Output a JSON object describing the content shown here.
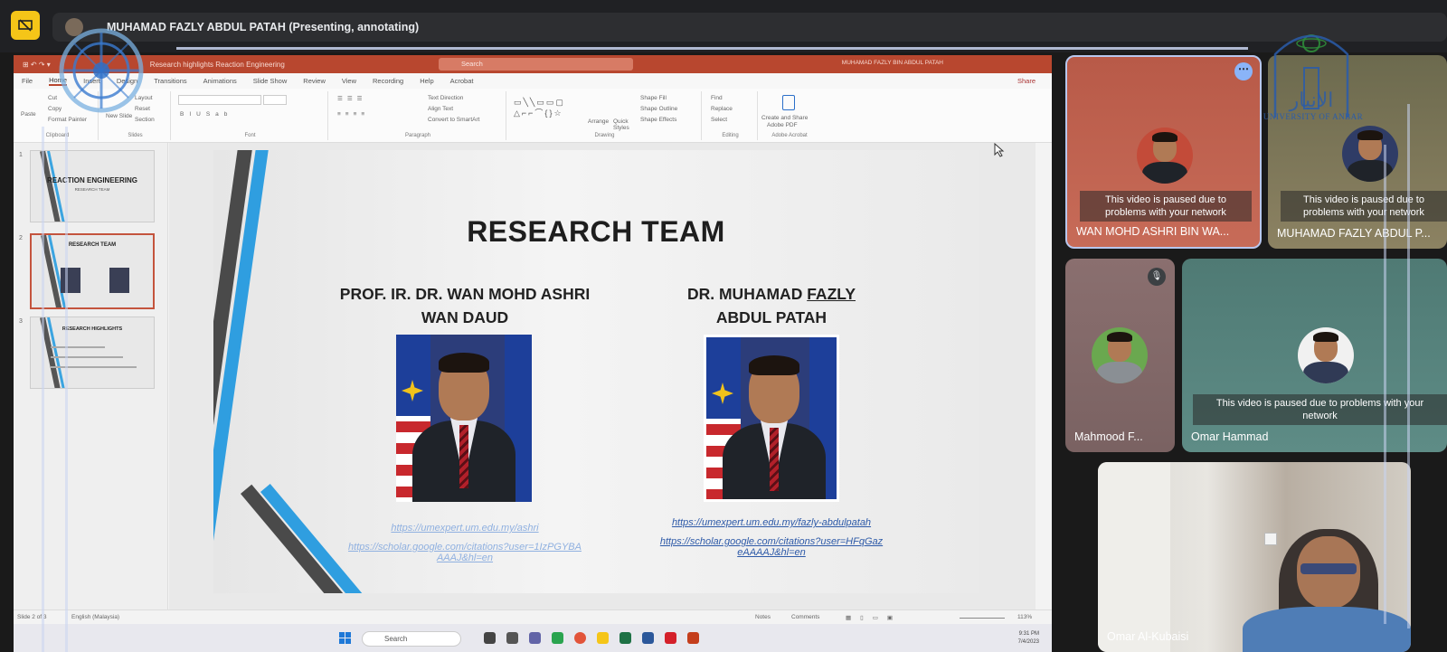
{
  "meet": {
    "presenting_text": "MUHAMAD FAZLY ABDUL PATAH (Presenting, annotating)"
  },
  "ppt": {
    "titlebar": {
      "filename": "Research highlights Reaction Engineering",
      "search": "Search",
      "user": "MUHAMAD FAZLY BIN ABDUL PATAH"
    },
    "tabs": [
      "File",
      "Home",
      "Insert",
      "Design",
      "Transitions",
      "Animations",
      "Slide Show",
      "Review",
      "View",
      "Recording",
      "Help",
      "Acrobat"
    ],
    "share": "Share",
    "ribbon": {
      "clipboard": {
        "paste": "Paste",
        "cut": "Cut",
        "copy": "Copy",
        "format_painter": "Format Painter",
        "label": "Clipboard"
      },
      "slides": {
        "new_slide": "New Slide",
        "layout": "Layout",
        "reset": "Reset",
        "section": "Section",
        "label": "Slides"
      },
      "font": {
        "label": "Font"
      },
      "paragraph": {
        "text_direction": "Text Direction",
        "align_text": "Align Text",
        "convert": "Convert to SmartArt",
        "label": "Paragraph"
      },
      "drawing": {
        "arrange": "Arrange",
        "quick_styles": "Quick Styles",
        "shape_fill": "Shape Fill",
        "shape_outline": "Shape Outline",
        "shape_effects": "Shape Effects",
        "label": "Drawing"
      },
      "editing": {
        "find": "Find",
        "replace": "Replace",
        "select": "Select",
        "label": "Editing"
      },
      "acrobat": {
        "create": "Create and Share",
        "create2": "Adobe PDF",
        "label": "Adobe Acrobat"
      }
    },
    "thumbnails": [
      {
        "num": "1",
        "title": "REACTION ENGINEERING",
        "sub": "RESEARCH TEAM"
      },
      {
        "num": "2",
        "title": "RESEARCH TEAM",
        "sub": ""
      },
      {
        "num": "3",
        "title": "RESEARCH HIGHLIGHTS",
        "sub": ""
      }
    ],
    "slide": {
      "title": "RESEARCH TEAM",
      "person1": {
        "line1": "PROF. IR. DR. WAN MOHD ASHRI",
        "line2": "WAN DAUD",
        "link1": "https://umexpert.um.edu.my/ashri",
        "link2a": "https://scholar.google.com/citations?user=1IzPGYBA",
        "link2b": "AAAJ&hl=en"
      },
      "person2": {
        "line1a": "DR. MUHAMAD ",
        "line1b": "FAZLY",
        "line2": "ABDUL PATAH",
        "link1": "https://umexpert.um.edu.my/fazly-abdulpatah",
        "link2a": "https://scholar.google.com/citations?user=HFqGaz",
        "link2b": "eAAAAJ&hl=en"
      }
    },
    "statusbar": {
      "slide": "Slide 2 of 3",
      "language": "English (Malaysia)",
      "notes": "Notes",
      "comments": "Comments",
      "zoom": "113%"
    },
    "taskbar": {
      "search": "Search",
      "time": "9:31 PM",
      "date": "7/4/2023"
    }
  },
  "participants": [
    {
      "name": "WAN MOHD ASHRI BIN WA...",
      "status": "This video is paused due to problems with your network"
    },
    {
      "name": "MUHAMAD FAZLY ABDUL P...",
      "status": "This video is paused due to problems with your network"
    },
    {
      "name": "Mahmood F..."
    },
    {
      "name": "Omar Hammad",
      "status": "This video is paused due to problems with your network"
    },
    {
      "name": "Omar Al-Kubaisi"
    }
  ],
  "logos": {
    "right_text": "UNIVERSITY OF ANBAR"
  },
  "colors": {
    "ppt_accent": "#b8472f",
    "slide_blue": "#2f9ee0",
    "meet_yellow": "#f5c518",
    "link_blue": "#2e5aa8"
  }
}
